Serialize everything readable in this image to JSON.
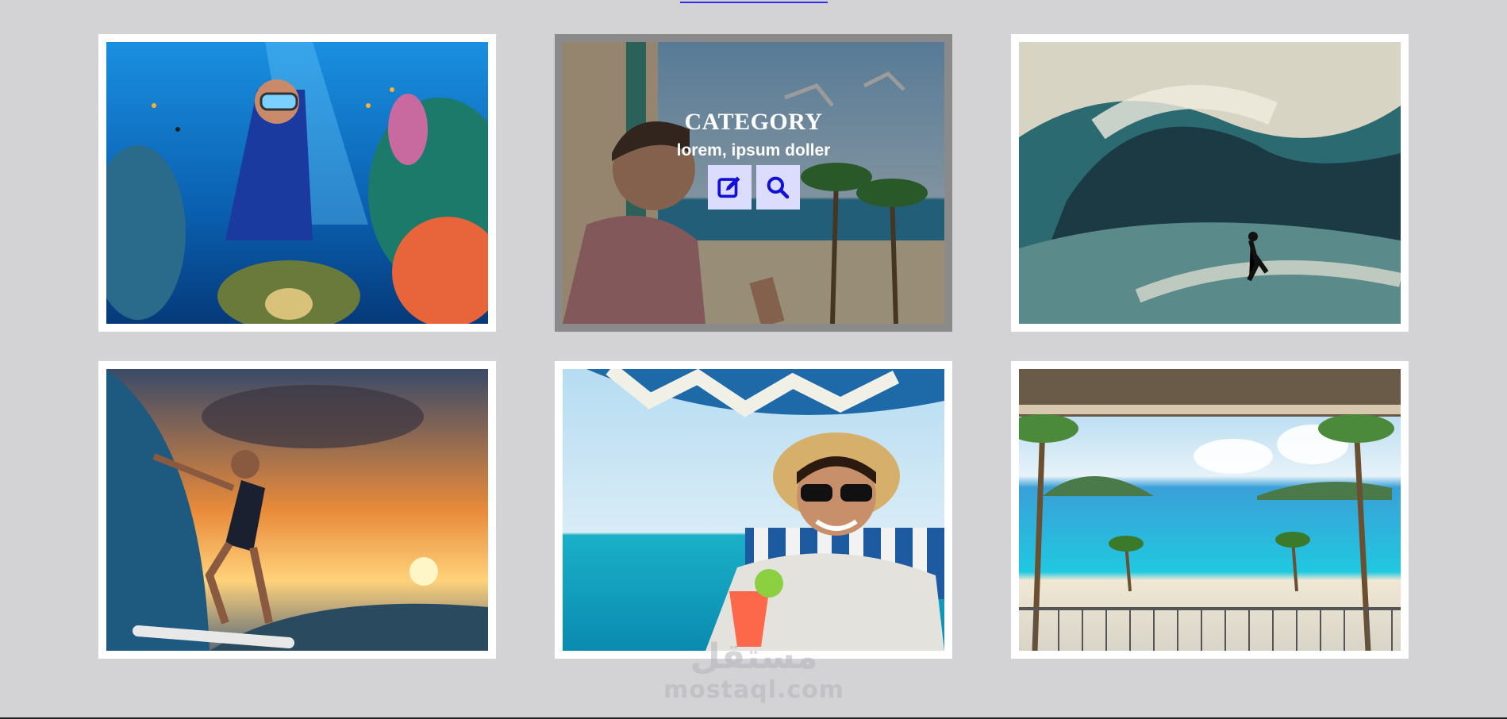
{
  "overlay": {
    "category": "CATEGORY",
    "subtitle": "lorem, ipsum doller"
  },
  "icons": {
    "edit": "edit-icon",
    "search": "search-icon"
  },
  "colors": {
    "background": "#d3d3d6",
    "frame": "#ffffff",
    "hover_frame": "#8a8a8a",
    "button_bg": "#dcdcff",
    "button_icon": "#1010d8",
    "top_line": "#2a2aff"
  },
  "gallery": [
    {
      "name": "scuba-diver-photo"
    },
    {
      "name": "beach-tourist-photo"
    },
    {
      "name": "big-wave-surfer-photo"
    },
    {
      "name": "sunset-surfer-photo"
    },
    {
      "name": "beach-cocktail-photo"
    },
    {
      "name": "balcony-view-photo"
    }
  ],
  "watermark": {
    "arabic": "مستقل",
    "latin": "mostaql.com"
  }
}
